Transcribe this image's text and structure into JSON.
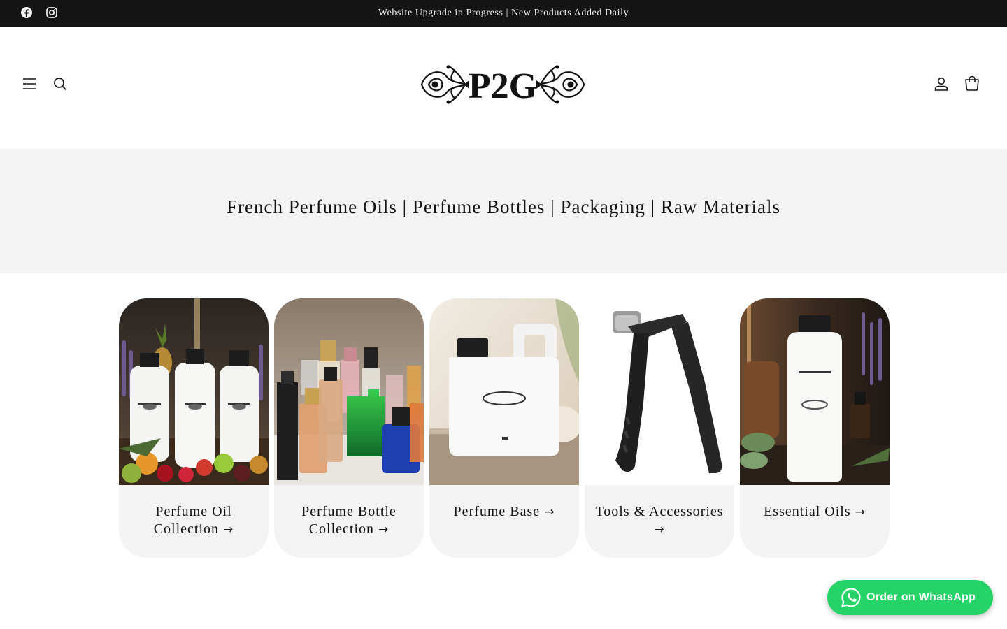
{
  "announcement": {
    "message": "Website Upgrade in Progress | New Products Added Daily",
    "social_icons": [
      "facebook-icon",
      "instagram-icon"
    ]
  },
  "header": {
    "logo_text": "P2G",
    "left_icons": [
      "menu-icon",
      "search-icon"
    ],
    "right_icons": [
      "account-icon",
      "cart-icon"
    ]
  },
  "banner": {
    "title": "French Perfume Oils | Perfume Bottles | Packaging | Raw Materials"
  },
  "collections": [
    {
      "label": "Perfume Oil Collection",
      "arrow": "→"
    },
    {
      "label": "Perfume Bottle Collection",
      "arrow": "→"
    },
    {
      "label": "Perfume Base",
      "arrow": "→"
    },
    {
      "label": "Tools & Accessories",
      "arrow": "→"
    },
    {
      "label": "Essential Oils",
      "arrow": "→"
    }
  ],
  "whatsapp": {
    "label": "Order on WhatsApp",
    "color": "#25d366"
  },
  "colors": {
    "announcement_bg": "#141414",
    "banner_bg": "#f3f3f3",
    "card_bg": "#f3f3f3"
  }
}
